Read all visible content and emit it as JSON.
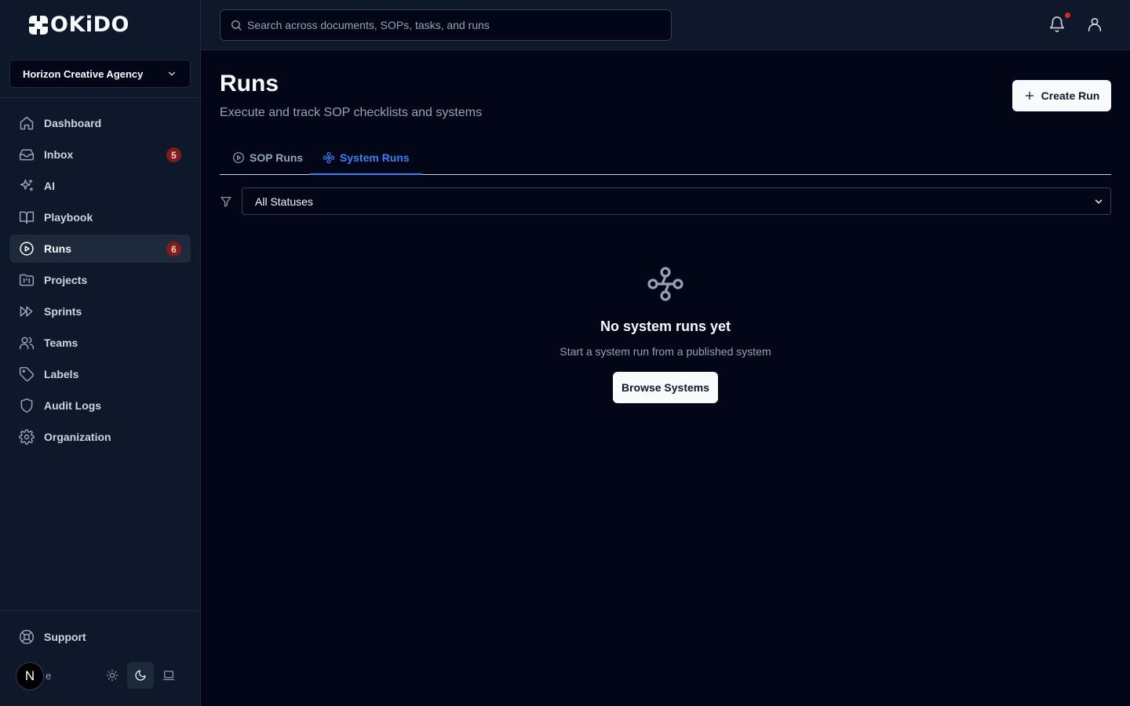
{
  "brand": {
    "name": "OKiDO"
  },
  "org_selector": {
    "value": "Horizon Creative Agency"
  },
  "sidebar": {
    "items": [
      {
        "label": "Dashboard",
        "icon": "home-icon"
      },
      {
        "label": "Inbox",
        "icon": "inbox-icon",
        "badge": "5"
      },
      {
        "label": "AI",
        "icon": "sparkles-icon"
      },
      {
        "label": "Playbook",
        "icon": "book-open-icon"
      },
      {
        "label": "Runs",
        "icon": "play-circle-icon",
        "badge": "6",
        "active": true
      },
      {
        "label": "Projects",
        "icon": "folder-kanban-icon"
      },
      {
        "label": "Sprints",
        "icon": "fast-forward-icon"
      },
      {
        "label": "Teams",
        "icon": "users-icon"
      },
      {
        "label": "Labels",
        "icon": "tag-icon"
      },
      {
        "label": "Audit Logs",
        "icon": "shield-icon"
      },
      {
        "label": "Organization",
        "icon": "gear-icon"
      }
    ],
    "support_label": "Support",
    "user": {
      "initial": "N",
      "name_fragment": "e"
    }
  },
  "search": {
    "placeholder": "Search across documents, SOPs, tasks, and runs"
  },
  "main": {
    "title": "Runs",
    "subtitle": "Execute and track SOP checklists and systems",
    "create_label": "Create Run",
    "tabs": [
      {
        "label": "SOP Runs",
        "icon": "play-circle-icon"
      },
      {
        "label": "System Runs",
        "icon": "workflow-icon",
        "active": true
      }
    ],
    "filter": {
      "selected": "All Statuses"
    },
    "empty": {
      "title": "No system runs yet",
      "subtitle": "Start a system run from a published system",
      "button_label": "Browse Systems"
    }
  },
  "colors": {
    "background": "#020617",
    "sidebar": "#0f172a",
    "accent": "#3b82f6",
    "badge": "#7f1d1d",
    "notification_dot": "#dc2626"
  }
}
